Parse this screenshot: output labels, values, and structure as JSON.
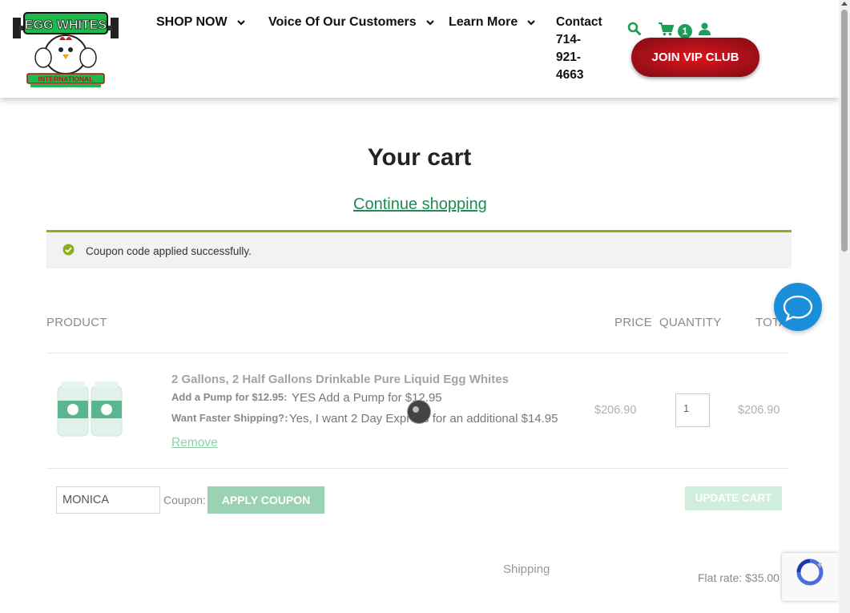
{
  "header": {
    "logo_title": "EGG WHITES",
    "logo_subtitle": "INTERNATIONAL",
    "nav": [
      {
        "label": "SHOP NOW"
      },
      {
        "label": "Voice Of Our Customers"
      },
      {
        "label": "Learn More"
      }
    ],
    "contact_label": "Contact",
    "contact_phone": [
      "714-",
      "921-",
      "4663"
    ],
    "cart_count": "1",
    "vip_button": "JOIN VIP CLUB"
  },
  "cart": {
    "title": "Your cart",
    "continue_link": "Continue shopping",
    "notice": "Coupon code applied successfully.",
    "columns": {
      "product": "PRODUCT",
      "price": "PRICE",
      "quantity": "QUANTITY",
      "total": "TOTA"
    },
    "item": {
      "name": "2 Gallons, 2 Half Gallons Drinkable Pure Liquid Egg Whites",
      "meta": [
        {
          "key": "Add a Pump for $12.95:",
          "value": "YES Add a Pump for $12.95"
        },
        {
          "key": "Want Faster Shipping?:",
          "value": "Yes, I want 2 Day Express for an additional $14.95"
        }
      ],
      "remove": "Remove",
      "price": "$206.90",
      "quantity": "1",
      "total": "$206.90"
    },
    "coupon_value": "MONICA",
    "coupon_label": "Coupon:",
    "apply_button": "APPLY COUPON",
    "update_button": "UPDATE CART",
    "shipping_label": "Shipping",
    "shipping_rate": "Flat rate: $35.00"
  },
  "colors": {
    "brand_green": "#1f8a55",
    "vip_red": "#a9101a",
    "notice_border": "#8fae1b",
    "chat_blue": "#1b8ed9"
  },
  "icons": {
    "search": "search-icon",
    "cart": "cart-icon",
    "account": "user-icon",
    "chat": "chat-icon"
  }
}
